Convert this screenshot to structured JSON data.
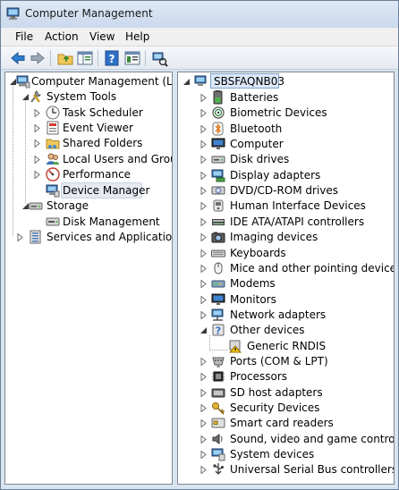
{
  "window": {
    "title": "Computer Management"
  },
  "menu": [
    "File",
    "Action",
    "View",
    "Help"
  ],
  "toolbar": [
    "back-icon",
    "forward-icon",
    "up-folder-icon",
    "show-hide-tree-icon",
    "help-icon",
    "properties-icon",
    "scan-hardware-icon"
  ],
  "left_tree": [
    {
      "label": "Computer Management (Local",
      "icon": "computer-management-icon",
      "expander": "expanded"
    },
    {
      "label": "System Tools",
      "icon": "system-tools-icon",
      "expander": "expanded"
    },
    {
      "label": "Task Scheduler",
      "icon": "clock-icon",
      "expander": "collapsed"
    },
    {
      "label": "Event Viewer",
      "icon": "event-viewer-icon",
      "expander": "collapsed"
    },
    {
      "label": "Shared Folders",
      "icon": "shared-folder-icon",
      "expander": "collapsed"
    },
    {
      "label": "Local Users and Groups",
      "icon": "users-icon",
      "expander": "collapsed"
    },
    {
      "label": "Performance",
      "icon": "performance-icon",
      "expander": "collapsed"
    },
    {
      "label": "Device Manager",
      "icon": "device-manager-icon",
      "expander": "none",
      "selected": true
    },
    {
      "label": "Storage",
      "icon": "storage-icon",
      "expander": "expanded"
    },
    {
      "label": "Disk Management",
      "icon": "disk-management-icon",
      "expander": "none"
    },
    {
      "label": "Services and Applications",
      "icon": "services-icon",
      "expander": "collapsed"
    }
  ],
  "right_tree": {
    "root": {
      "label": "SBSFAQNB03",
      "icon": "computer-icon"
    },
    "categories": [
      {
        "label": "Batteries",
        "icon": "battery-icon"
      },
      {
        "label": "Biometric Devices",
        "icon": "fingerprint-icon"
      },
      {
        "label": "Bluetooth",
        "icon": "bluetooth-icon"
      },
      {
        "label": "Computer",
        "icon": "monitor-icon"
      },
      {
        "label": "Disk drives",
        "icon": "disk-drive-icon"
      },
      {
        "label": "Display adapters",
        "icon": "display-adapter-icon"
      },
      {
        "label": "DVD/CD-ROM drives",
        "icon": "dvd-icon"
      },
      {
        "label": "Human Interface Devices",
        "icon": "hid-icon"
      },
      {
        "label": "IDE ATA/ATAPI controllers",
        "icon": "ide-controller-icon"
      },
      {
        "label": "Imaging devices",
        "icon": "camera-icon"
      },
      {
        "label": "Keyboards",
        "icon": "keyboard-icon"
      },
      {
        "label": "Mice and other pointing devices",
        "icon": "mouse-icon"
      },
      {
        "label": "Modems",
        "icon": "modem-icon"
      },
      {
        "label": "Monitors",
        "icon": "monitor-icon"
      },
      {
        "label": "Network adapters",
        "icon": "network-adapter-icon"
      },
      {
        "label": "Other devices",
        "icon": "other-devices-icon",
        "expanded": true
      },
      {
        "label": "Generic RNDIS",
        "icon": "warning-device-icon",
        "child": true
      },
      {
        "label": "Ports (COM & LPT)",
        "icon": "port-icon"
      },
      {
        "label": "Processors",
        "icon": "processor-icon"
      },
      {
        "label": "SD host adapters",
        "icon": "sd-host-icon"
      },
      {
        "label": "Security Devices",
        "icon": "key-icon"
      },
      {
        "label": "Smart card readers",
        "icon": "smart-card-icon"
      },
      {
        "label": "Sound, video and game controllers",
        "icon": "speaker-icon"
      },
      {
        "label": "System devices",
        "icon": "system-devices-icon"
      },
      {
        "label": "Universal Serial Bus controllers",
        "icon": "usb-icon"
      }
    ]
  }
}
